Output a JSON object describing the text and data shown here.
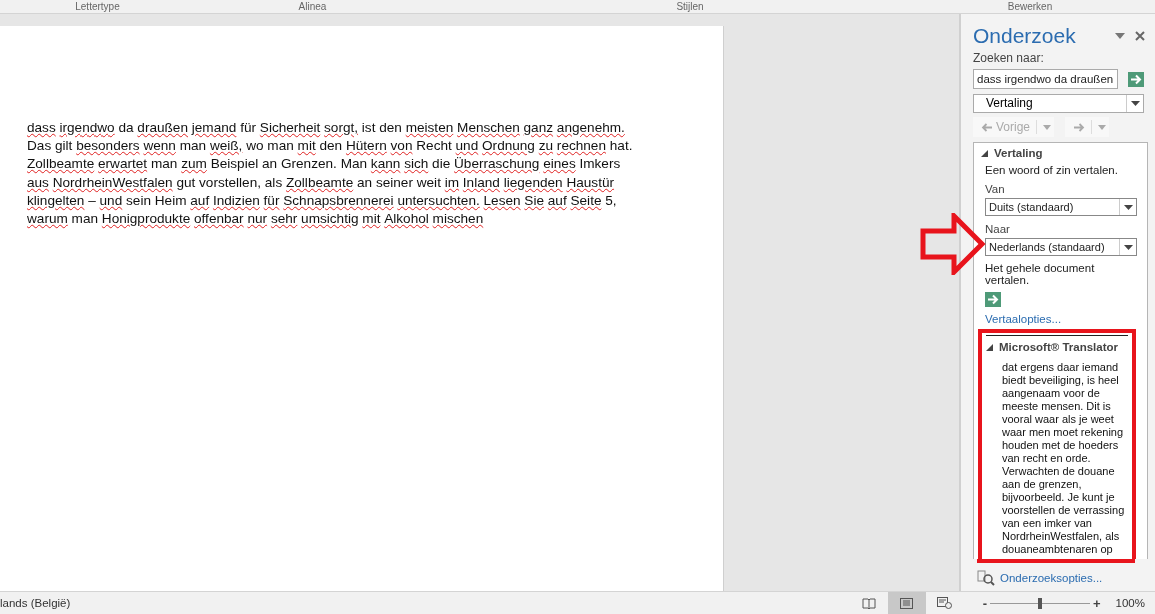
{
  "ribbon_groups": [
    "Lettertype",
    "Alinea",
    "Stijlen",
    "Bewerken"
  ],
  "document": {
    "lines": [
      [
        {
          "w": "dass",
          "misspelled": true
        },
        {
          "w": "irgendwo",
          "misspelled": true
        },
        {
          "w": "da",
          "misspelled": false
        },
        {
          "w": "draußen",
          "misspelled": true
        },
        {
          "w": "jemand",
          "misspelled": true
        },
        {
          "w": "für",
          "misspelled": false
        },
        {
          "w": "Sicherheit",
          "misspelled": true
        },
        {
          "w": "sorgt,",
          "misspelled": true
        },
        {
          "w": "ist",
          "misspelled": false
        },
        {
          "w": "den",
          "misspelled": false
        },
        {
          "w": "meisten",
          "misspelled": true
        },
        {
          "w": "Menschen",
          "misspelled": true
        },
        {
          "w": "ganz",
          "misspelled": true
        },
        {
          "w": "angenehm.",
          "misspelled": true
        }
      ],
      [
        {
          "w": "Das",
          "misspelled": false
        },
        {
          "w": "gilt",
          "misspelled": false
        },
        {
          "w": "besonders",
          "misspelled": true
        },
        {
          "w": "wenn",
          "misspelled": true
        },
        {
          "w": "man",
          "misspelled": false
        },
        {
          "w": "weiß,",
          "misspelled": true
        },
        {
          "w": "wo",
          "misspelled": false
        },
        {
          "w": "man",
          "misspelled": false
        },
        {
          "w": "mit",
          "misspelled": true
        },
        {
          "w": "den",
          "misspelled": false
        },
        {
          "w": "Hütern",
          "misspelled": true
        },
        {
          "w": "von",
          "misspelled": true
        },
        {
          "w": "Recht",
          "misspelled": false
        },
        {
          "w": "und",
          "misspelled": true
        },
        {
          "w": "Ordnung",
          "misspelled": true
        },
        {
          "w": "zu",
          "misspelled": true
        },
        {
          "w": "rechnen",
          "misspelled": true
        },
        {
          "w": "hat.",
          "misspelled": false
        }
      ],
      [
        {
          "w": "Zollbeamte",
          "misspelled": true
        },
        {
          "w": "erwartet",
          "misspelled": true
        },
        {
          "w": "man",
          "misspelled": false
        },
        {
          "w": "zum",
          "misspelled": true
        },
        {
          "w": "Beispiel",
          "misspelled": false
        },
        {
          "w": "an",
          "misspelled": false
        },
        {
          "w": "Grenzen.",
          "misspelled": false
        },
        {
          "w": "Man",
          "misspelled": false
        },
        {
          "w": "kann",
          "misspelled": true
        },
        {
          "w": "sich",
          "misspelled": true
        },
        {
          "w": "die",
          "misspelled": false
        },
        {
          "w": "Überraschung",
          "misspelled": true
        },
        {
          "w": "eines",
          "misspelled": true
        },
        {
          "w": "Imkers",
          "misspelled": false
        }
      ],
      [
        {
          "w": "aus",
          "misspelled": true
        },
        {
          "w": "NordrheinWestfalen",
          "misspelled": true
        },
        {
          "w": "gut",
          "misspelled": false
        },
        {
          "w": "vorstellen,",
          "misspelled": false
        },
        {
          "w": "als",
          "misspelled": false
        },
        {
          "w": "Zollbeamte",
          "misspelled": true
        },
        {
          "w": "an",
          "misspelled": false
        },
        {
          "w": "seiner",
          "misspelled": false
        },
        {
          "w": "weit",
          "misspelled": false
        },
        {
          "w": "im",
          "misspelled": true
        },
        {
          "w": "Inland",
          "misspelled": true
        },
        {
          "w": "liegenden",
          "misspelled": true
        },
        {
          "w": "Haustür",
          "misspelled": true
        }
      ],
      [
        {
          "w": "klingelten",
          "misspelled": true
        },
        {
          "w": "–",
          "misspelled": false
        },
        {
          "w": "und",
          "misspelled": true
        },
        {
          "w": "sein",
          "misspelled": false
        },
        {
          "w": "Heim",
          "misspelled": false
        },
        {
          "w": "auf",
          "misspelled": true
        },
        {
          "w": "Indizien",
          "misspelled": true
        },
        {
          "w": "für",
          "misspelled": true
        },
        {
          "w": "Schnapsbrennerei",
          "misspelled": true
        },
        {
          "w": "untersuchten.",
          "misspelled": true
        },
        {
          "w": "Lesen",
          "misspelled": true
        },
        {
          "w": "Sie",
          "misspelled": true
        },
        {
          "w": "auf",
          "misspelled": true
        },
        {
          "w": "Seite",
          "misspelled": true
        },
        {
          "w": "5,",
          "misspelled": false
        }
      ],
      [
        {
          "w": "warum",
          "misspelled": true
        },
        {
          "w": "man",
          "misspelled": false
        },
        {
          "w": "Honigprodukte",
          "misspelled": true
        },
        {
          "w": "offenbar",
          "misspelled": true
        },
        {
          "w": "nur",
          "misspelled": true
        },
        {
          "w": "sehr",
          "misspelled": true
        },
        {
          "w": "umsichtig",
          "misspelled": true
        },
        {
          "w": "mit",
          "misspelled": true
        },
        {
          "w": "Alkohol",
          "misspelled": true
        },
        {
          "w": "mischen",
          "misspelled": true
        }
      ]
    ]
  },
  "research_pane": {
    "title": "Onderzoek",
    "search_label": "Zoeken naar:",
    "search_value": "dass irgendwo da draußen",
    "service": "Vertaling",
    "back_button": {
      "label": "Vorige",
      "disabled": true
    },
    "forward_button": {
      "disabled": true
    },
    "translation_section": {
      "title": "Vertaling",
      "expanded": true,
      "hint": "Een woord of zin vertalen.",
      "from_label": "Van",
      "from_value": "Duits (standaard)",
      "to_label": "Naar",
      "to_value": "Nederlands (standaard)",
      "whole_document": "Het gehele document vertalen.",
      "options_link": "Vertaalopties..."
    },
    "translator_section": {
      "title": "Microsoft® Translator",
      "expanded": true,
      "result_lines": [
        "dat ergens daar iemand",
        "biedt beveiliging, is heel",
        "aangenaam voor de",
        "meeste mensen. Dit is",
        "vooral waar als je weet",
        "waar men moet rekening",
        "houden met de hoeders",
        "van recht en orde.",
        "Verwachten de douane",
        "aan de grenzen,",
        "bijvoorbeeld. Je kunt je",
        "voorstellen de verrassing",
        "van een imker van",
        "NordrheinWestfalen, als",
        "douaneambtenaren op"
      ]
    },
    "options_link": "Onderzoeksopties..."
  },
  "status_bar": {
    "language": "lands (België)",
    "views": [
      {
        "kind": "read",
        "selected": false
      },
      {
        "kind": "print",
        "selected": true
      },
      {
        "kind": "web",
        "selected": false
      }
    ],
    "zoom_minus": "-",
    "zoom_plus": "+",
    "zoom_slider": {
      "level": 0.5
    },
    "zoom": "100%"
  }
}
